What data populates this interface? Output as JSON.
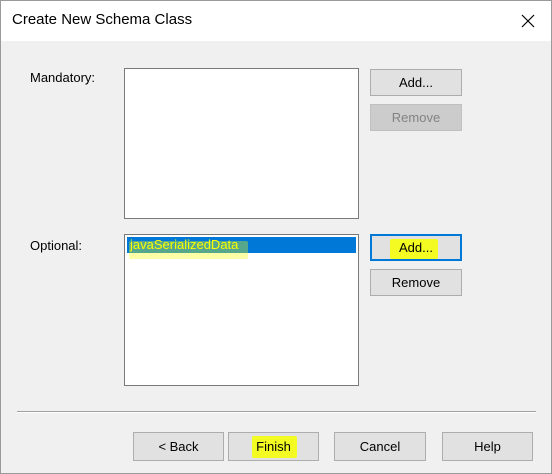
{
  "window": {
    "title": "Create New Schema Class"
  },
  "mandatory": {
    "label": "Mandatory:",
    "items": [],
    "add_label": "Add...",
    "remove_label": "Remove"
  },
  "optional": {
    "label": "Optional:",
    "items": [
      {
        "label": "javaSerializedData",
        "selected": true
      }
    ],
    "add_label": "Add...",
    "remove_label": "Remove"
  },
  "footer": {
    "back_label": "< Back",
    "finish_label": "Finish",
    "cancel_label": "Cancel",
    "help_label": "Help"
  },
  "colors": {
    "selection": "#0078d7",
    "highlight": "#f6ff00",
    "dialog_background": "#f0f0f0"
  }
}
